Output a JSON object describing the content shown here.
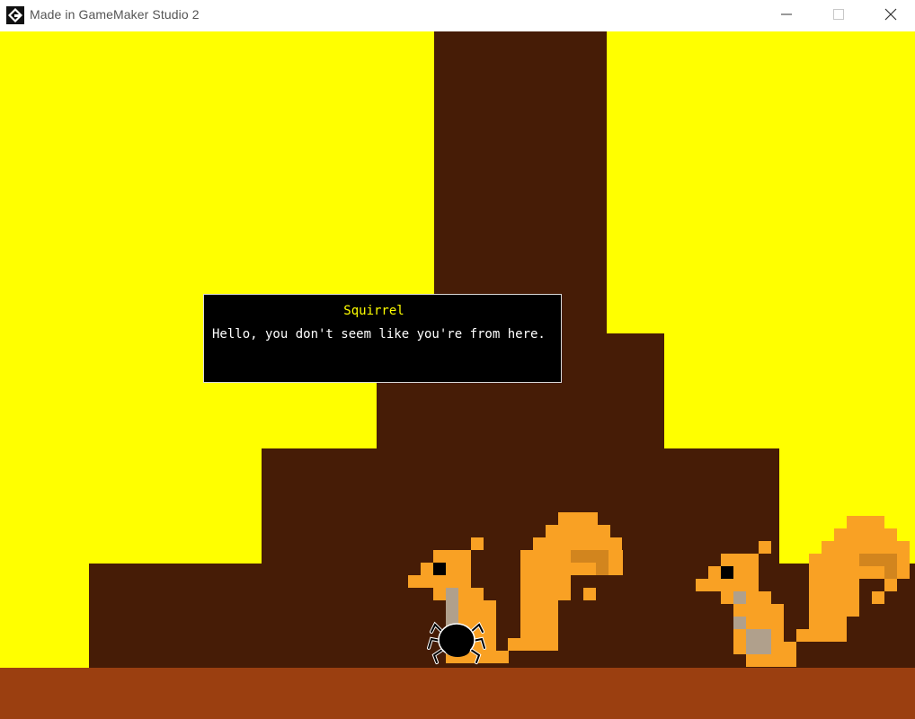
{
  "window": {
    "title": "Made in GameMaker Studio 2",
    "controls": [
      "minimize",
      "maximize",
      "close"
    ]
  },
  "dialog": {
    "speaker": "Squirrel",
    "text": "Hello, you don't seem like you're from here."
  },
  "colors": {
    "sky": "#ffff00",
    "tree": "#461c06",
    "ground": "#9b3f10",
    "squirrel": "#f9a124",
    "squirrel_shade": "#d2851e",
    "squirrel_belly": "#b0a08c",
    "dialog_name": "#ffff00",
    "dialog_text": "#ffffff"
  },
  "characters": [
    "squirrel",
    "squirrel",
    "spider-player"
  ]
}
